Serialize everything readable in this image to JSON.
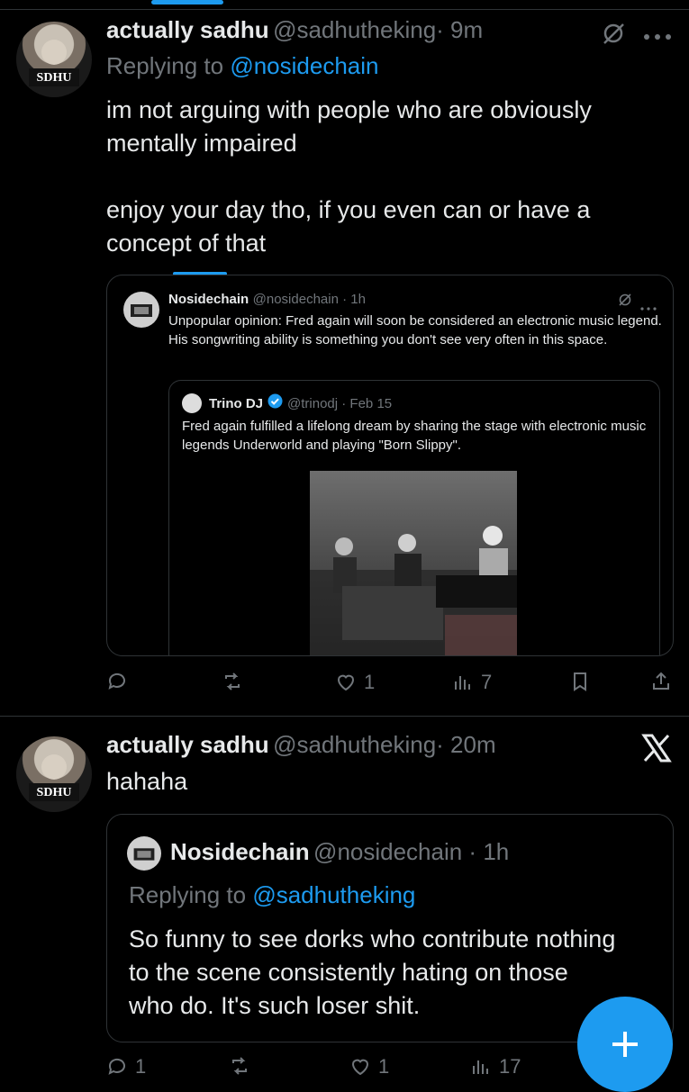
{
  "tweet1": {
    "name": "actually sadhu",
    "handle": "@sadhutheking",
    "time": "· 9m",
    "replying_prefix": "Replying to ",
    "replying_to": "@nosidechain",
    "text": "im not arguing with people who are obviously\nmentally impaired\n\nenjoy your day tho, if you even can or have a\nconcept of that",
    "quote": {
      "name": "Nosidechain",
      "handle": "@nosidechain · 1h",
      "text": "Unpopular opinion: Fred again will soon be considered an electronic music legend. His songwriting ability is something you don't see very often in this space.",
      "nested": {
        "name": "Trino DJ",
        "handle": "@trinodj · Feb 15",
        "text": "Fred again fulfilled a lifelong dream by sharing the stage with electronic music legends Underworld and playing \"Born Slippy\"."
      }
    },
    "actions": {
      "replies": "",
      "retweets": "",
      "likes": "1",
      "views": "7"
    }
  },
  "tweet2": {
    "name": "actually sadhu",
    "handle": "@sadhutheking",
    "time": "· 20m",
    "text": "hahaha",
    "quote": {
      "name": "Nosidechain",
      "handle": "@nosidechain · 1h",
      "replying_prefix": "Replying to ",
      "replying_to": "@sadhutheking",
      "text": "So funny to see dorks who contribute nothing\nto the scene consistently hating on those\nwho do. It's such loser shit."
    },
    "actions": {
      "replies": "1",
      "retweets": "",
      "likes": "1",
      "views": "17"
    }
  },
  "icons": {
    "reply": "reply-icon",
    "retweet": "retweet-icon",
    "like": "heart-icon",
    "views": "views-icon",
    "bookmark": "bookmark-icon",
    "share": "share-icon",
    "grok": "grok-icon",
    "more": "more-icon",
    "x_logo": "x-logo-icon",
    "verified": "verified-badge-icon",
    "compose": "compose-plus-icon"
  },
  "colors": {
    "accent": "#1d9bf0",
    "muted": "#71767b",
    "text": "#e7e9ea",
    "border": "#2f3336",
    "background": "#000000"
  }
}
